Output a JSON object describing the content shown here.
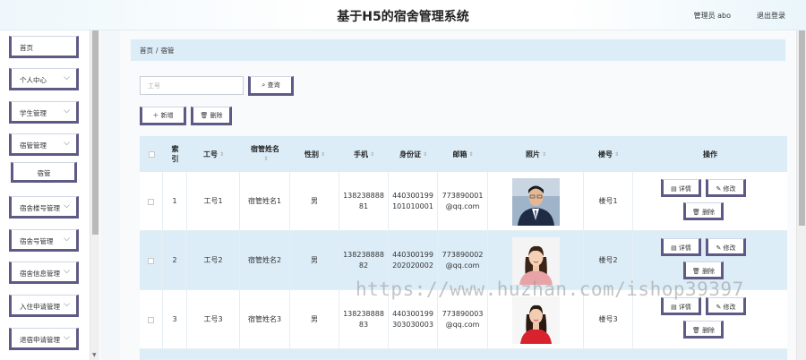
{
  "header": {
    "title": "基于H5的宿舍管理系统",
    "user_label": "管理员 abo",
    "logout_label": "退出登录"
  },
  "sidebar": {
    "items": [
      {
        "label": "首页"
      },
      {
        "label": "个人中心"
      },
      {
        "label": "学生管理"
      },
      {
        "label": "宿管管理"
      },
      {
        "label": "宿管"
      },
      {
        "label": "宿舍楼号管理"
      },
      {
        "label": "宿舍号管理"
      },
      {
        "label": "宿舍信息管理"
      },
      {
        "label": "入住申请管理"
      },
      {
        "label": "退宿申请管理"
      }
    ]
  },
  "breadcrumb": {
    "home": "首页",
    "current": "宿管"
  },
  "search": {
    "placeholder": "工号",
    "query_label": "查询"
  },
  "toolbar": {
    "add_label": "新增",
    "delete_label": "删除"
  },
  "table": {
    "columns": {
      "index": "索引",
      "job_no": "工号",
      "name": "宿管姓名",
      "gender": "性别",
      "phone": "手机",
      "id_card": "身份证",
      "email": "邮箱",
      "photo": "照片",
      "building": "楼号",
      "actions": "操作"
    },
    "rows": [
      {
        "index": "1",
        "job_no": "工号1",
        "name": "宿管姓名1",
        "gender": "男",
        "phone": "138238888 81",
        "id_card": "440300199 101010001",
        "email": "773890001 @qq.com",
        "building": "楼号1"
      },
      {
        "index": "2",
        "job_no": "工号2",
        "name": "宿管姓名2",
        "gender": "男",
        "phone": "138238888 82",
        "id_card": "440300199 202020002",
        "email": "773890002 @qq.com",
        "building": "楼号2"
      },
      {
        "index": "3",
        "job_no": "工号3",
        "name": "宿管姓名3",
        "gender": "男",
        "phone": "138238888 83",
        "id_card": "440300199 303030003",
        "email": "773890003 @qq.com",
        "building": "楼号3"
      }
    ],
    "action_labels": {
      "detail": "详情",
      "edit": "修改",
      "delete": "删除"
    }
  },
  "watermark": "https://www.huzhan.com/ishop39397"
}
